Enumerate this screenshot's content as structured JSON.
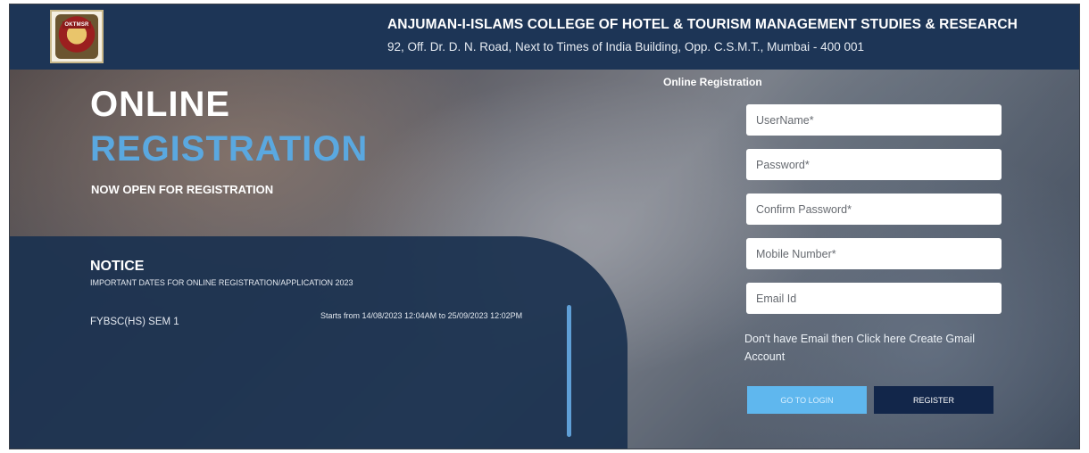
{
  "header": {
    "logo_label": "OKTMSR",
    "college_name": "ANJUMAN-I-ISLAMS COLLEGE OF HOTEL & TOURISM MANAGEMENT STUDIES & RESEARCH",
    "address": "92, Off. Dr. D. N. Road, Next to Times of India Building, Opp. C.S.M.T., Mumbai - 400 001"
  },
  "hero": {
    "line1": "ONLINE",
    "line2": "REGISTRATION",
    "subtitle": "NOW OPEN FOR REGISTRATION"
  },
  "notice": {
    "title": "NOTICE",
    "subtitle": "IMPORTANT DATES FOR ONLINE REGISTRATION/APPLICATION 2023",
    "items": [
      {
        "course": "FYBSC(HS) SEM 1",
        "dates": "Starts from 14/08/2023 12:04AM to 25/09/2023 12:02PM"
      }
    ]
  },
  "form": {
    "heading": "Online Registration",
    "username_placeholder": "UserName*",
    "password_placeholder": "Password*",
    "confirm_password_placeholder": "Confirm Password*",
    "mobile_placeholder": "Mobile Number*",
    "email_placeholder": "Email Id",
    "gmail_note": "Don't have Email then Click here Create Gmail Account",
    "login_label": "GO TO LOGIN",
    "register_label": "REGISTER"
  },
  "colors": {
    "header_bg": "#1d3556",
    "accent_blue": "#5aa8e0",
    "login_button": "#5fb7ee",
    "register_button": "#12264a",
    "notice_panel": "#1b3150"
  }
}
